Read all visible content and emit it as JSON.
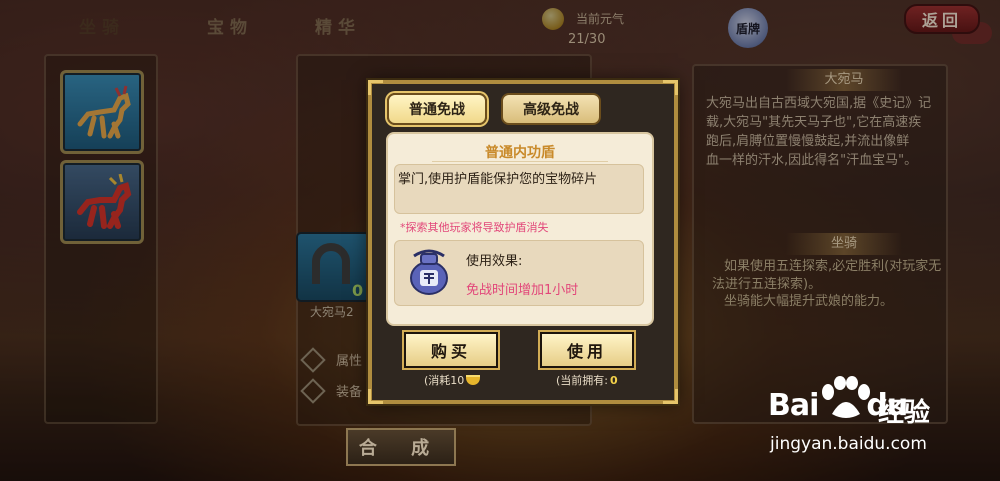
{
  "tabs": [
    {
      "label": "坐骑",
      "active": true
    },
    {
      "label": "宝物",
      "active": false
    },
    {
      "label": "精华",
      "active": false
    }
  ],
  "vitality": {
    "label": "当前元气",
    "value": "21/30"
  },
  "badge": {
    "label": "盾牌"
  },
  "back_button": "返回",
  "mounts": [
    {
      "icon": "blue-horse-icon"
    },
    {
      "icon": "red-horse-icon"
    }
  ],
  "item": {
    "count": "0",
    "name": "大宛马2"
  },
  "attributes": [
    "属性",
    "装备"
  ],
  "compose_button": "合  成",
  "description": {
    "title": "大宛马",
    "lines": [
      "大宛马出自古西域大宛国,据《史记》记",
      "载,大宛马\"其先天马子也\",它在高速疾",
      "跑后,肩膊位置慢慢鼓起,并流出像鲜",
      "血一样的汗水,因此得名\"汗血宝马\"。"
    ],
    "section_title": "坐骑",
    "section_lines": [
      "如果使用五连探索,必定胜利(对玩家无",
      "法进行五连探索)。",
      "坐骑能大幅提升武娘的能力。"
    ]
  },
  "modal": {
    "tab_normal": "普通免战",
    "tab_advanced": "高级免战",
    "shield_name": "普通内功盾",
    "description": "掌门,使用护盾能保护您的宝物碎片",
    "warning": "*探索其他玩家将导致护盾消失",
    "effect_label": "使用效果:",
    "effect_value": "免战时间增加1小时",
    "buy_button": "购买",
    "use_button": "使用",
    "cost_text": "(消耗10",
    "owned_text": "(当前拥有:",
    "owned_count": "0",
    "colors": {
      "frame": "#b08d3f",
      "warning": "#e2477a",
      "title": "#c98a2a"
    }
  },
  "watermark": {
    "logo": "Bai",
    "logo2": "du",
    "cn": "经验",
    "url": "jingyan.baidu.com"
  }
}
